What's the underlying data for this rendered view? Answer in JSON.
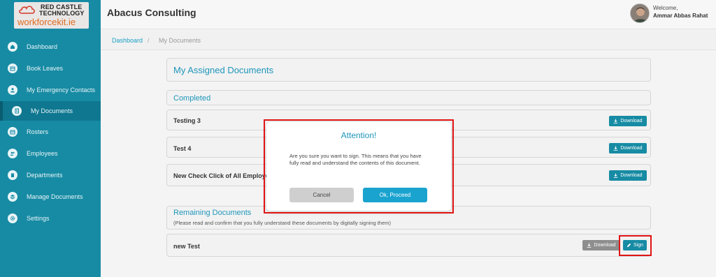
{
  "brand": {
    "line1": "RED CASTLE",
    "line2": "TECHNOLOGY",
    "product": "workforcekit.ie"
  },
  "header": {
    "title": "Abacus Consulting",
    "welcome": "Welcome,",
    "user_name": "Ammar Abbas Rahat"
  },
  "sidebar": {
    "items": [
      {
        "label": "Dashboard",
        "icon": "home-icon"
      },
      {
        "label": "Book Leaves",
        "icon": "calendar-icon"
      },
      {
        "label": "My Emergency Contacts",
        "icon": "user-icon"
      },
      {
        "label": "My Documents",
        "icon": "document-icon",
        "active": true
      },
      {
        "label": "Rosters",
        "icon": "calendar-icon"
      },
      {
        "label": "Employees",
        "icon": "users-icon"
      },
      {
        "label": "Departments",
        "icon": "building-icon"
      },
      {
        "label": "Manage Documents",
        "icon": "documents-icon"
      },
      {
        "label": "Settings",
        "icon": "gear-icon"
      }
    ]
  },
  "breadcrumb": {
    "link": "Dashboard",
    "separator": "/",
    "current": "My Documents"
  },
  "main": {
    "page_title": "My Assigned Documents",
    "completed_title": "Completed",
    "completed_docs": [
      {
        "name": "Testing 3",
        "action": "Download"
      },
      {
        "name": "Test 4",
        "action": "Download"
      },
      {
        "name": "New Check Click of All Employees",
        "action": "Download"
      }
    ],
    "remaining_title": "Remaining Documents",
    "remaining_subtitle": "(Please read and confirm that you fully understand these documents by digitally signing them)",
    "remaining_docs": [
      {
        "name": "new Test",
        "download": "Download",
        "sign": "Sign"
      }
    ]
  },
  "modal": {
    "title": "Attention!",
    "body": "Are you sure you want to sign. This means that you have fully read and understand the contents of this document.",
    "cancel": "Cancel",
    "ok": "Ok, Proceed"
  },
  "colors": {
    "sidebar": "#178ba4",
    "accent": "#1e96bb",
    "highlight": "#e01414",
    "logo_brand": "#e06a1c"
  }
}
